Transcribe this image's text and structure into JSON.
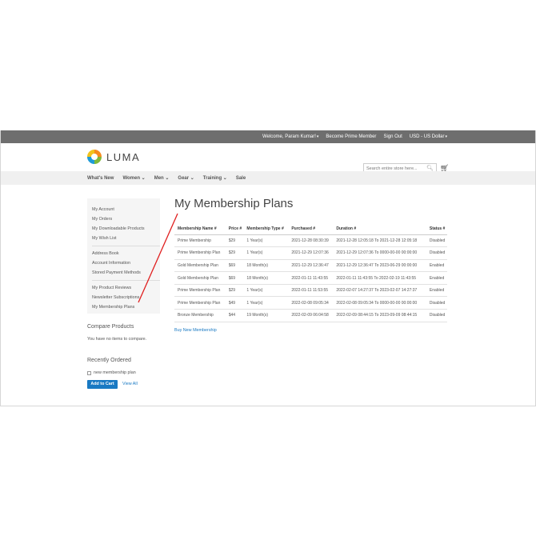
{
  "topbar": {
    "welcome": "Welcome, Param Kumar!",
    "become_member": "Become Prime Member",
    "sign_out": "Sign Out",
    "currency": "USD - US Dollar"
  },
  "header": {
    "logo_text": "LUMA",
    "search_placeholder": "Search entire store here...",
    "accent": "#1979c3"
  },
  "nav": {
    "items": [
      {
        "label": "What's New"
      },
      {
        "label": "Women"
      },
      {
        "label": "Men"
      },
      {
        "label": "Gear"
      },
      {
        "label": "Training"
      },
      {
        "label": "Sale"
      }
    ]
  },
  "sidebar": {
    "group1": [
      "My Account",
      "My Orders",
      "My Downloadable Products",
      "My Wish List"
    ],
    "group2": [
      "Address Book",
      "Account Information",
      "Stored Payment Methods"
    ],
    "group3": [
      "My Product Reviews",
      "Newsletter Subscriptions",
      "My Membership Plans"
    ],
    "compare_title": "Compare Products",
    "compare_empty": "You have no items to compare.",
    "recent_title": "Recently Ordered",
    "recent_item": "new membership plan",
    "add_to_cart": "Add to Cart",
    "view_all": "View All"
  },
  "main": {
    "title": "My Membership Plans",
    "columns": [
      "Membership Name #",
      "Price #",
      "Membership Type #",
      "Purchased #",
      "Duration #",
      "Status #"
    ],
    "rows": [
      [
        "Prime Membership",
        "$29",
        "1 Year(s)",
        "2021-12-28 08:30:39",
        "2021-12-28 12:05:18 To 2021-12-28 12:05:18",
        "Disabled"
      ],
      [
        "Prime Membership Plan",
        "$29",
        "1 Year(s)",
        "2021-12-29 12:07:36",
        "2021-12-29 12:07:36 To 0000-00-00 00:00:00",
        "Disabled"
      ],
      [
        "Gold Membership Plan",
        "$69",
        "18 Month(s)",
        "2021-12-29 12:36:47",
        "2021-12-29 12:36:47 To 2023-06-29 00:00:00",
        "Enabled"
      ],
      [
        "Gold Membership Plan",
        "$69",
        "18 Month(s)",
        "2022-01-11 11:43:55",
        "2022-01-11 11:43:55 To 2022-02-19 11:43:55",
        "Enabled"
      ],
      [
        "Prime Membership Plan",
        "$29",
        "1 Year(s)",
        "2022-01-11 11:53:55",
        "2022-02-07 14:27:37 To 2023-02-07 14:27:37",
        "Enabled"
      ],
      [
        "Prime Membership Plan",
        "$49",
        "1 Year(s)",
        "2022-02-08 09:05:34",
        "2022-02-08 09:05:34 To 0000-00-00 00:00:00",
        "Disabled"
      ],
      [
        "Bronze Membership",
        "$44",
        "19 Month(s)",
        "2022-02-09 06:04:58",
        "2022-02-09 08:44:15 To 2023-09-09 08:44:15",
        "Disabled"
      ]
    ],
    "buy_new": "Buy New Membership"
  },
  "annotation": {
    "color": "#e01e1e"
  }
}
